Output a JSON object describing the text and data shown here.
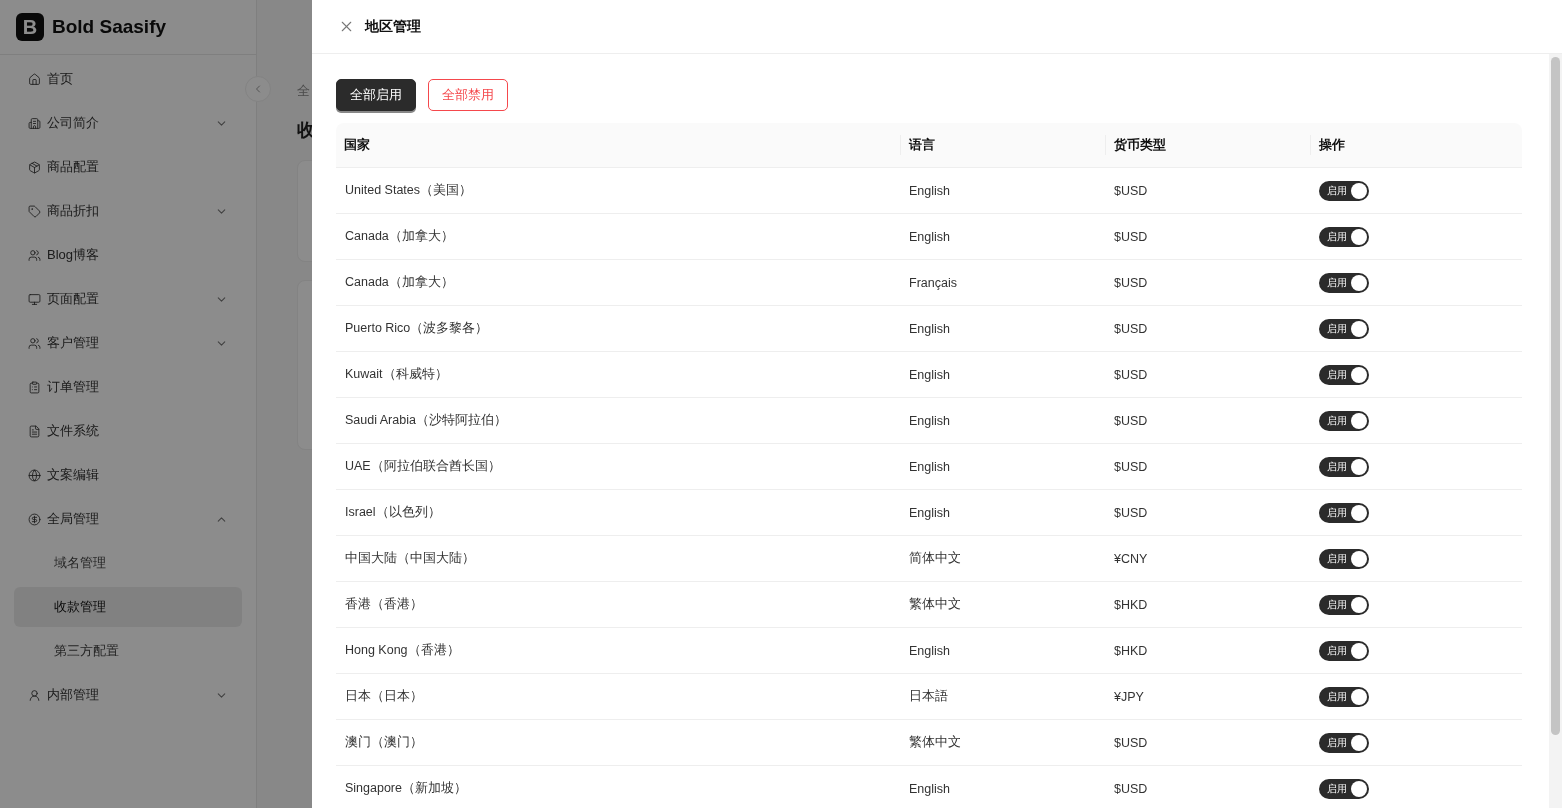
{
  "brand": {
    "logo_letter": "B",
    "name": "Bold Saasify"
  },
  "sidebar": {
    "items": [
      {
        "label": "首页",
        "selected": false
      },
      {
        "label": "公司简介",
        "expanded": false,
        "selected": false
      },
      {
        "label": "商品配置",
        "selected": false
      },
      {
        "label": "商品折扣",
        "expanded": false,
        "selected": false
      },
      {
        "label": "Blog博客",
        "selected": false
      },
      {
        "label": "页面配置",
        "expanded": false,
        "selected": false
      },
      {
        "label": "客户管理",
        "expanded": false,
        "selected": false
      },
      {
        "label": "订单管理",
        "selected": false
      },
      {
        "label": "文件系统",
        "selected": false
      },
      {
        "label": "文案编辑",
        "selected": false
      },
      {
        "label": "全局管理",
        "expanded": true,
        "selected": false,
        "children": [
          {
            "label": "域名管理",
            "selected": false
          },
          {
            "label": "收款管理",
            "selected": true
          },
          {
            "label": "第三方配置",
            "selected": false
          }
        ]
      },
      {
        "label": "内部管理",
        "expanded": false,
        "selected": false
      }
    ]
  },
  "page": {
    "breadcrumb": "全",
    "title": "收"
  },
  "drawer": {
    "title": "地区管理",
    "buttons": [
      {
        "label": "全部启用",
        "kind": "primary"
      },
      {
        "label": "全部禁用",
        "kind": "danger"
      }
    ],
    "table": {
      "columns": [
        "国家",
        "语言",
        "货币类型",
        "操作"
      ],
      "rows": [
        {
          "country": "United States（美国）",
          "language": "English",
          "currency": "$USD",
          "toggle": {
            "label": "启用",
            "on": true
          }
        },
        {
          "country": "Canada（加拿大）",
          "language": "English",
          "currency": "$USD",
          "toggle": {
            "label": "启用",
            "on": true
          }
        },
        {
          "country": "Canada（加拿大）",
          "language": "Français",
          "currency": "$USD",
          "toggle": {
            "label": "启用",
            "on": true
          }
        },
        {
          "country": "Puerto Rico（波多黎各）",
          "language": "English",
          "currency": "$USD",
          "toggle": {
            "label": "启用",
            "on": true
          }
        },
        {
          "country": "Kuwait（科威特）",
          "language": "English",
          "currency": "$USD",
          "toggle": {
            "label": "启用",
            "on": true
          }
        },
        {
          "country": "Saudi Arabia（沙特阿拉伯）",
          "language": "English",
          "currency": "$USD",
          "toggle": {
            "label": "启用",
            "on": true
          }
        },
        {
          "country": "UAE（阿拉伯联合酋长国）",
          "language": "English",
          "currency": "$USD",
          "toggle": {
            "label": "启用",
            "on": true
          }
        },
        {
          "country": "Israel（以色列）",
          "language": "English",
          "currency": "$USD",
          "toggle": {
            "label": "启用",
            "on": true
          }
        },
        {
          "country": "中国大陆（中国大陆）",
          "language": "简体中文",
          "currency": "¥CNY",
          "toggle": {
            "label": "启用",
            "on": true
          }
        },
        {
          "country": "香港（香港）",
          "language": "繁体中文",
          "currency": "$HKD",
          "toggle": {
            "label": "启用",
            "on": true
          }
        },
        {
          "country": "Hong Kong（香港）",
          "language": "English",
          "currency": "$HKD",
          "toggle": {
            "label": "启用",
            "on": true
          }
        },
        {
          "country": "日本（日本）",
          "language": "日本語",
          "currency": "¥JPY",
          "toggle": {
            "label": "启用",
            "on": true
          }
        },
        {
          "country": "澳门（澳门）",
          "language": "繁体中文",
          "currency": "$USD",
          "toggle": {
            "label": "启用",
            "on": true
          }
        },
        {
          "country": "Singapore（新加坡）",
          "language": "English",
          "currency": "$USD",
          "toggle": {
            "label": "启用",
            "on": true
          }
        }
      ]
    }
  }
}
